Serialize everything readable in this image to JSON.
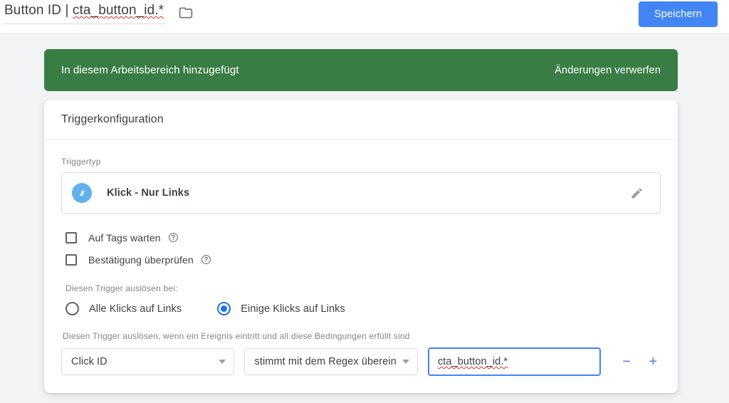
{
  "topbar": {
    "title_prefix": "Button ID | ",
    "title_value": "cta_button_id.*",
    "folder_icon": "folder-icon",
    "save_label": "Speichern"
  },
  "banner": {
    "message": "In diesem Arbeitsbereich hinzugefügt",
    "action_label": "Änderungen verwerfen"
  },
  "card": {
    "header_title": "Triggerkonfiguration",
    "trigger_type": {
      "label": "Triggertyp",
      "icon": "link-icon",
      "name": "Klick - Nur Links",
      "edit_icon": "pencil-icon"
    },
    "checkboxes": [
      {
        "label": "Auf Tags warten",
        "checked": false,
        "help_icon": "help-circle-icon"
      },
      {
        "label": "Bestätigung überprüfen",
        "checked": false,
        "help_icon": "help-circle-icon"
      }
    ],
    "fire_on": {
      "label": "Diesen Trigger auslösen bei:",
      "options": [
        {
          "label": "Alle Klicks auf Links",
          "selected": false
        },
        {
          "label": "Einige Klicks auf Links",
          "selected": true
        }
      ]
    },
    "conditions": {
      "label": "Diesen Trigger auslösen, wenn ein Ereignis eintritt und all diese Bedingungen erfüllt sind",
      "variable_select": "Click ID",
      "operator_select": "stimmt mit dem Regex überein",
      "value_input": "cta_button_id.*",
      "remove_label": "−",
      "add_label": "+"
    }
  },
  "colors": {
    "accent_blue": "#4285f4",
    "banner_green": "#3a7d44",
    "trigger_icon_blue": "#62b0ee",
    "page_bg": "#f1f3f4"
  }
}
